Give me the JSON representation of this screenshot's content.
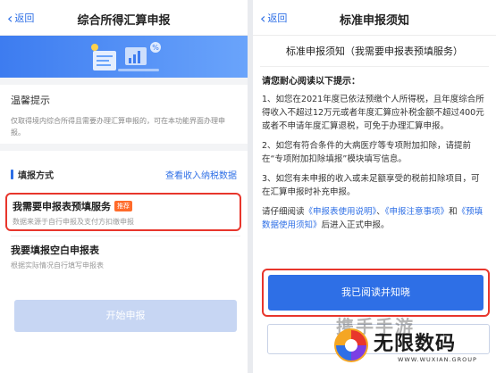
{
  "left": {
    "back_label": "返回",
    "title": "综合所得汇算申报",
    "tips_title": "温馨提示",
    "tips_text": "仅取得境内综合所得且需要办理汇算申报的，可在本功能界面办理申报。",
    "method_label": "填报方式",
    "method_link": "查看收入纳税数据",
    "option1": {
      "title": "我需要申报表预填服务",
      "badge": "推荐",
      "subtitle": "数据来源于自行申报及支付方扣缴申报"
    },
    "option2": {
      "title": "我要填报空白申报表",
      "subtitle": "根据实际情况自行填写申报表"
    },
    "start_button": "开始申报"
  },
  "right": {
    "back_label": "返回",
    "title": "标准申报须知",
    "notice_title": "标准申报须知（我需要申报表预填服务）",
    "intro": "请您耐心阅读以下提示：",
    "para1": "1、如您在2021年度已依法预缴个人所得税，且年度综合所得收入不超过12万元或者年度汇算应补税金额不超过400元或者不申请年度汇算退税，可免于办理汇算申报。",
    "para2": "2、如您有符合条件的大病医疗等专项附加扣除，请提前在“专项附加扣除填报”模块填写信息。",
    "para3": "3、如您有未申报的收入或未足额享受的税前扣除项目，可在汇算申报时补充申报。",
    "para4_prefix": "请仔细阅读",
    "para4_link1": "《申报表使用说明》",
    "para4_sep1": "、",
    "para4_link2": "《申报注意事项》",
    "para4_and": "和",
    "para4_link3": "《预填数据使用须知》",
    "para4_suffix": "后进入正式申报。",
    "agree_button": "我已阅读并知晓"
  },
  "watermark": {
    "ghost": "携手手游",
    "brand": "无限数码",
    "sub": "WWW.WUXIAN.GROUP"
  },
  "colors": {
    "accent": "#2e6fe6",
    "highlight": "#e8362c",
    "badge": "#ff6b2b",
    "disabled_button": "#c7d6f3"
  }
}
